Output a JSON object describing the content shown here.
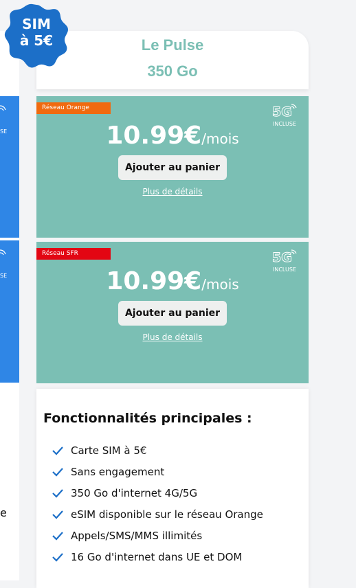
{
  "badge": {
    "line1": "SIM",
    "line2": "à 5€",
    "color": "#1c6fc8"
  },
  "plan": {
    "name": "Le Pulse",
    "data": "350 Go",
    "accent": "#7bbfb4"
  },
  "offers": [
    {
      "network": "Réseau Orange",
      "network_color": "#f06a0f",
      "fiveg_label": "INCLUSE",
      "price": "10.99€",
      "unit": "/mois",
      "cart_label": "Ajouter au panier",
      "details_label": "Plus de détails"
    },
    {
      "network": "Réseau SFR",
      "network_color": "#e30613",
      "fiveg_label": "INCLUSE",
      "price": "10.99€",
      "unit": "/mois",
      "cart_label": "Ajouter au panier",
      "details_label": "Plus de détails"
    }
  ],
  "features": {
    "title": "Fonctionnalités principales :",
    "items": [
      "Carte SIM à 5€",
      "Sans engagement",
      "350 Go d'internet 4G/5G",
      "eSIM disponible sur le réseau Orange",
      "Appels/SMS/MMS illimités",
      "16 Go d'internet dans UE et DOM"
    ]
  },
  "left_card": {
    "fragment_se": "SE",
    "fragment_e": "e",
    "accent": "#2f86e6"
  }
}
